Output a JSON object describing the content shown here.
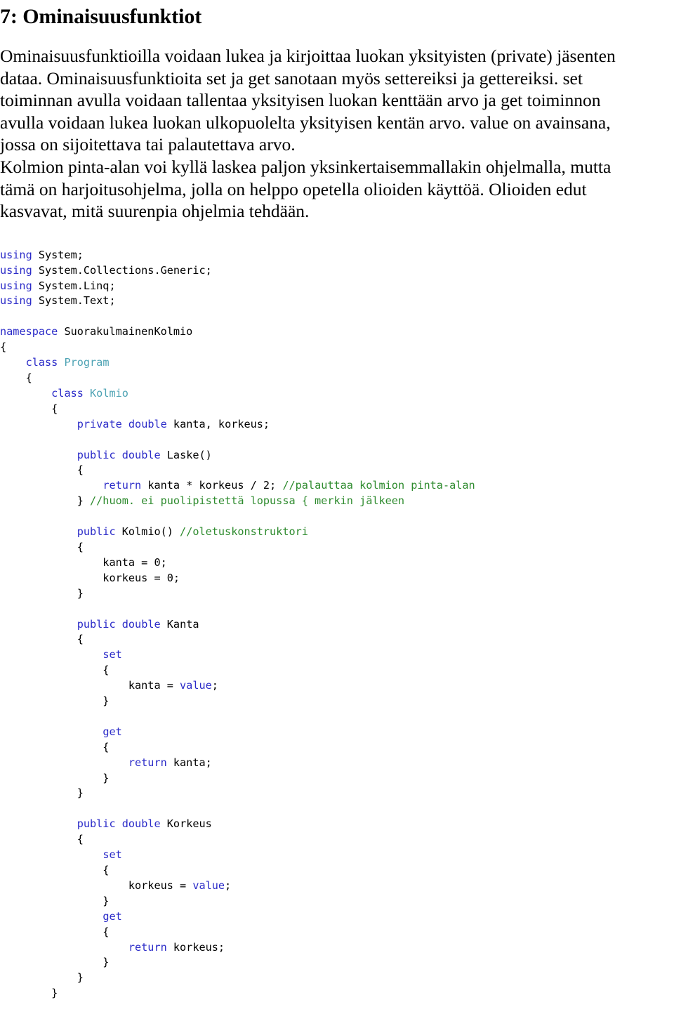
{
  "document": {
    "title": "7: Ominaisuusfunktiot",
    "prose_lines": [
      "Ominaisuusfunktioilla voidaan lukea ja kirjoittaa luokan yksityisten (private) jäsenten",
      "dataa. Ominaisuusfunktioita set ja get sanotaan myös settereiksi ja gettereiksi. set",
      "toiminnan avulla voidaan tallentaa yksityisen luokan kenttään arvo ja get toiminnon",
      "avulla voidaan lukea luokan ulkopuolelta yksityisen kentän arvo. value on avainsana,",
      "jossa on sijoitettava tai palautettava arvo.",
      "Kolmion pinta-alan voi kyllä laskea paljon yksinkertaisemmallakin ohjelmalla, mutta",
      "tämä on harjoitusohjelma, jolla on helppo opetella olioiden käyttöä. Olioiden edut",
      "kasvavat, mitä suurenpia ohjelmia tehdään."
    ],
    "code": {
      "language": "csharp",
      "colors": {
        "keyword": "#2B2BC8",
        "type": "#4EA3B4",
        "comment": "#2E8B2E",
        "plain": "#000000",
        "background": "#FFFFFF"
      },
      "lines": [
        [
          {
            "t": "using",
            "c": "kw"
          },
          {
            "t": " System;",
            "c": "pln"
          }
        ],
        [
          {
            "t": "using",
            "c": "kw"
          },
          {
            "t": " System.Collections.Generic;",
            "c": "pln"
          }
        ],
        [
          {
            "t": "using",
            "c": "kw"
          },
          {
            "t": " System.Linq;",
            "c": "pln"
          }
        ],
        [
          {
            "t": "using",
            "c": "kw"
          },
          {
            "t": " System.Text;",
            "c": "pln"
          }
        ],
        [],
        [
          {
            "t": "namespace",
            "c": "kw"
          },
          {
            "t": " SuorakulmainenKolmio",
            "c": "pln"
          }
        ],
        [
          {
            "t": "{",
            "c": "pln"
          }
        ],
        [
          {
            "t": "    ",
            "c": "pln"
          },
          {
            "t": "class",
            "c": "kw"
          },
          {
            "t": " ",
            "c": "pln"
          },
          {
            "t": "Program",
            "c": "typ"
          }
        ],
        [
          {
            "t": "    {",
            "c": "pln"
          }
        ],
        [
          {
            "t": "        ",
            "c": "pln"
          },
          {
            "t": "class",
            "c": "kw"
          },
          {
            "t": " ",
            "c": "pln"
          },
          {
            "t": "Kolmio",
            "c": "typ"
          }
        ],
        [
          {
            "t": "        {",
            "c": "pln"
          }
        ],
        [
          {
            "t": "            ",
            "c": "pln"
          },
          {
            "t": "private",
            "c": "kw"
          },
          {
            "t": " ",
            "c": "pln"
          },
          {
            "t": "double",
            "c": "kw"
          },
          {
            "t": " kanta, korkeus;",
            "c": "pln"
          }
        ],
        [],
        [
          {
            "t": "            ",
            "c": "pln"
          },
          {
            "t": "public",
            "c": "kw"
          },
          {
            "t": " ",
            "c": "pln"
          },
          {
            "t": "double",
            "c": "kw"
          },
          {
            "t": " Laske()",
            "c": "pln"
          }
        ],
        [
          {
            "t": "            {",
            "c": "pln"
          }
        ],
        [
          {
            "t": "                ",
            "c": "pln"
          },
          {
            "t": "return",
            "c": "kw"
          },
          {
            "t": " kanta * korkeus / 2; ",
            "c": "pln"
          },
          {
            "t": "//palauttaa kolmion pinta-alan",
            "c": "cmt"
          }
        ],
        [
          {
            "t": "            } ",
            "c": "pln"
          },
          {
            "t": "//huom. ei puolipistettä lopussa { merkin jälkeen",
            "c": "cmt"
          }
        ],
        [],
        [
          {
            "t": "            ",
            "c": "pln"
          },
          {
            "t": "public",
            "c": "kw"
          },
          {
            "t": " Kolmio() ",
            "c": "pln"
          },
          {
            "t": "//oletuskonstruktori",
            "c": "cmt"
          }
        ],
        [
          {
            "t": "            {",
            "c": "pln"
          }
        ],
        [
          {
            "t": "                kanta = 0;",
            "c": "pln"
          }
        ],
        [
          {
            "t": "                korkeus = 0;",
            "c": "pln"
          }
        ],
        [
          {
            "t": "            }",
            "c": "pln"
          }
        ],
        [],
        [
          {
            "t": "            ",
            "c": "pln"
          },
          {
            "t": "public",
            "c": "kw"
          },
          {
            "t": " ",
            "c": "pln"
          },
          {
            "t": "double",
            "c": "kw"
          },
          {
            "t": " Kanta",
            "c": "pln"
          }
        ],
        [
          {
            "t": "            {",
            "c": "pln"
          }
        ],
        [
          {
            "t": "                ",
            "c": "pln"
          },
          {
            "t": "set",
            "c": "kw"
          }
        ],
        [
          {
            "t": "                {",
            "c": "pln"
          }
        ],
        [
          {
            "t": "                    kanta = ",
            "c": "pln"
          },
          {
            "t": "value",
            "c": "kw"
          },
          {
            "t": ";",
            "c": "pln"
          }
        ],
        [
          {
            "t": "                }",
            "c": "pln"
          }
        ],
        [],
        [
          {
            "t": "                ",
            "c": "pln"
          },
          {
            "t": "get",
            "c": "kw"
          }
        ],
        [
          {
            "t": "                {",
            "c": "pln"
          }
        ],
        [
          {
            "t": "                    ",
            "c": "pln"
          },
          {
            "t": "return",
            "c": "kw"
          },
          {
            "t": " kanta;",
            "c": "pln"
          }
        ],
        [
          {
            "t": "                }",
            "c": "pln"
          }
        ],
        [
          {
            "t": "            }",
            "c": "pln"
          }
        ],
        [],
        [
          {
            "t": "            ",
            "c": "pln"
          },
          {
            "t": "public",
            "c": "kw"
          },
          {
            "t": " ",
            "c": "pln"
          },
          {
            "t": "double",
            "c": "kw"
          },
          {
            "t": " Korkeus",
            "c": "pln"
          }
        ],
        [
          {
            "t": "            {",
            "c": "pln"
          }
        ],
        [
          {
            "t": "                ",
            "c": "pln"
          },
          {
            "t": "set",
            "c": "kw"
          }
        ],
        [
          {
            "t": "                {",
            "c": "pln"
          }
        ],
        [
          {
            "t": "                    korkeus = ",
            "c": "pln"
          },
          {
            "t": "value",
            "c": "kw"
          },
          {
            "t": ";",
            "c": "pln"
          }
        ],
        [
          {
            "t": "                }",
            "c": "pln"
          }
        ],
        [
          {
            "t": "                ",
            "c": "pln"
          },
          {
            "t": "get",
            "c": "kw"
          }
        ],
        [
          {
            "t": "                {",
            "c": "pln"
          }
        ],
        [
          {
            "t": "                    ",
            "c": "pln"
          },
          {
            "t": "return",
            "c": "kw"
          },
          {
            "t": " korkeus;",
            "c": "pln"
          }
        ],
        [
          {
            "t": "                }",
            "c": "pln"
          }
        ],
        [
          {
            "t": "            }",
            "c": "pln"
          }
        ],
        [
          {
            "t": "        }",
            "c": "pln"
          }
        ]
      ]
    }
  }
}
